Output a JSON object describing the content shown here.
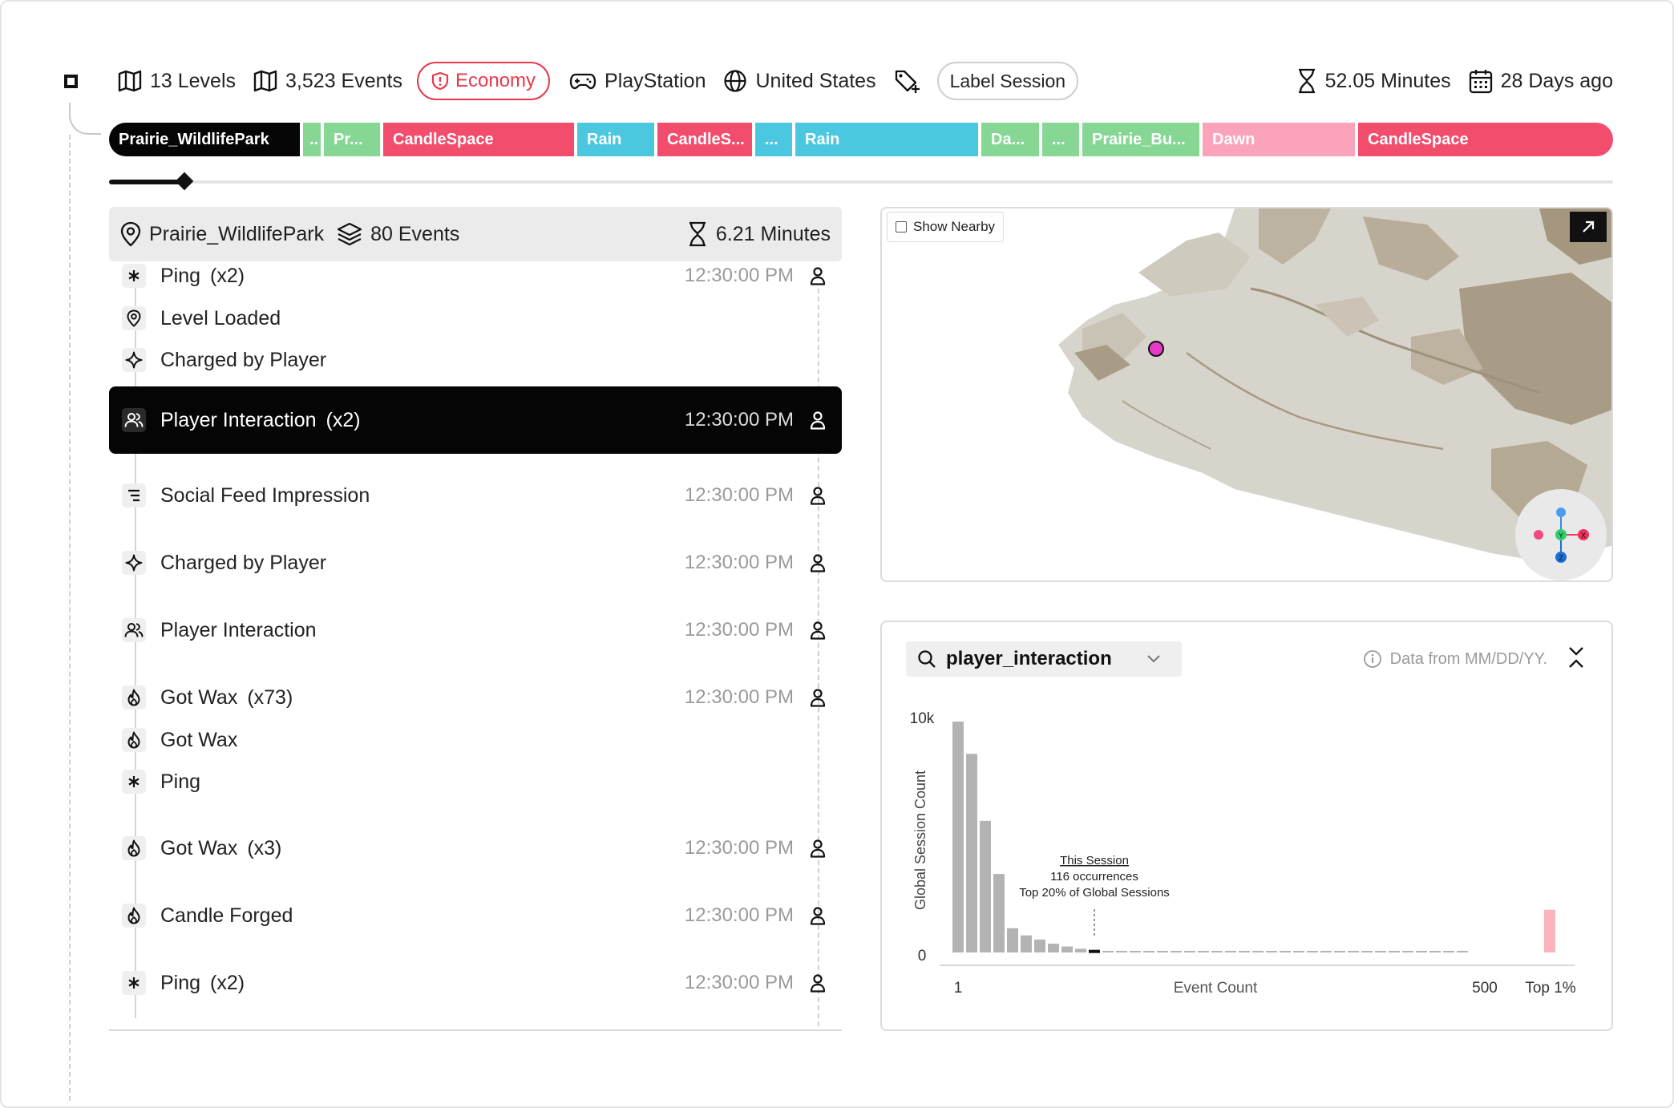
{
  "header": {
    "levels": "13 Levels",
    "events": "3,523 Events",
    "tag": "Economy",
    "platform": "PlayStation",
    "country": "United States",
    "label_button": "Label Session",
    "duration": "52.05 Minutes",
    "date": "28 Days ago"
  },
  "segments": [
    {
      "label": "Prairie_WildlifePark",
      "color": "#050505"
    },
    {
      "label": "..",
      "color": "#86d694"
    },
    {
      "label": "Pr...",
      "color": "#86d694"
    },
    {
      "label": "CandleSpace",
      "color": "#f24d6c"
    },
    {
      "label": "Rain",
      "color": "#4bc8e0"
    },
    {
      "label": "CandleS...",
      "color": "#f24d6c"
    },
    {
      "label": "...",
      "color": "#4bc8e0"
    },
    {
      "label": "Rain",
      "color": "#4bc8e0"
    },
    {
      "label": "Da...",
      "color": "#86d694"
    },
    {
      "label": "...",
      "color": "#86d694"
    },
    {
      "label": "Prairie_Bu...",
      "color": "#86d694"
    },
    {
      "label": "Dawn",
      "color": "#fba3bb"
    },
    {
      "label": "CandleSpace",
      "color": "#f24d6c"
    }
  ],
  "timeline": {
    "position": 0.05
  },
  "level_panel": {
    "name": "Prairie_WildlifePark",
    "events": "80 Events",
    "duration": "6.21 Minutes"
  },
  "events": [
    {
      "icon": "asterisk-icon",
      "name": "Ping",
      "count": "(x2)",
      "time": "12:30:00 PM",
      "player": true
    },
    {
      "icon": "location-icon",
      "name": "Level Loaded",
      "count": "",
      "time": "",
      "player": false
    },
    {
      "icon": "sparkle-icon",
      "name": "Charged by Player",
      "count": "",
      "time": "",
      "player": false
    },
    {
      "icon": "users-icon",
      "name": "Player Interaction",
      "count": "(x2)",
      "time": "12:30:00 PM",
      "player": true,
      "selected": true
    },
    {
      "icon": "list-icon",
      "name": "Social Feed Impression",
      "count": "",
      "time": "12:30:00 PM",
      "player": true
    },
    {
      "icon": "sparkle-icon",
      "name": "Charged by Player",
      "count": "",
      "time": "12:30:00 PM",
      "player": true
    },
    {
      "icon": "users-icon",
      "name": "Player Interaction",
      "count": "",
      "time": "12:30:00 PM",
      "player": true
    },
    {
      "icon": "flame-icon",
      "name": "Got Wax",
      "count": "(x73)",
      "time": "12:30:00 PM",
      "player": true
    },
    {
      "icon": "flame-icon",
      "name": "Got Wax",
      "count": "",
      "time": "",
      "player": false
    },
    {
      "icon": "asterisk-icon",
      "name": "Ping",
      "count": "",
      "time": "",
      "player": false
    },
    {
      "icon": "flame-icon",
      "name": "Got Wax",
      "count": "(x3)",
      "time": "12:30:00 PM",
      "player": true
    },
    {
      "icon": "flame-icon",
      "name": "Candle Forged",
      "count": "",
      "time": "12:30:00 PM",
      "player": true
    },
    {
      "icon": "asterisk-icon",
      "name": "Ping",
      "count": "(x2)",
      "time": "12:30:00 PM",
      "player": true
    }
  ],
  "map": {
    "show_nearby": "Show Nearby",
    "player_marker_color": "#e83ac8",
    "axes": {
      "x": "X",
      "y": "Y",
      "z": "Z"
    }
  },
  "chart_panel": {
    "query": "player_interaction",
    "data_from": "Data from MM/DD/YY."
  },
  "chart_data": {
    "type": "bar",
    "title": "",
    "xlabel": "Event Count",
    "ylabel": "Global Session Count",
    "y_ticks": [
      "10k",
      "0"
    ],
    "x_ticks": [
      "1",
      "500",
      "Top 1%"
    ],
    "ylim": [
      0,
      10000
    ],
    "values": [
      10000,
      8600,
      5700,
      3400,
      1050,
      740,
      560,
      380,
      260,
      160,
      80,
      60,
      60,
      60,
      60,
      60,
      60,
      60,
      60,
      60,
      60,
      60,
      60,
      60,
      60,
      60,
      60,
      60,
      60,
      60,
      60,
      60,
      60,
      60,
      60,
      60,
      60,
      60
    ],
    "highlight_index": 10,
    "top_bucket_value": 1850,
    "colors": {
      "bar": "#b3b3b3",
      "highlight": "#111111",
      "top": "#fbb4bd"
    },
    "annotation": {
      "title": "This Session",
      "line1": "116 occurrences",
      "line2": "Top 20% of Global Sessions"
    }
  }
}
